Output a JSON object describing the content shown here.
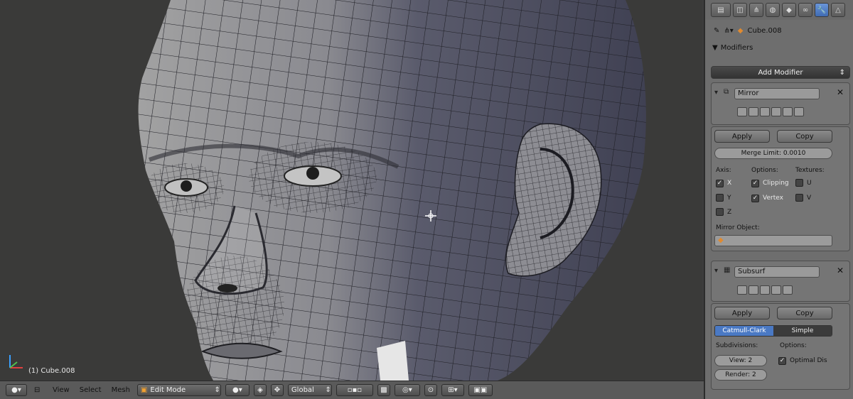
{
  "viewport": {
    "object_label": "(1) Cube.008"
  },
  "header": {
    "menus": [
      "View",
      "Select",
      "Mesh"
    ],
    "mode": "Edit Mode",
    "orientation": "Global"
  },
  "properties": {
    "context_object": "Cube.008",
    "section_title": "Modifiers",
    "add_modifier": "Add Modifier",
    "mirror": {
      "name": "Mirror",
      "apply": "Apply",
      "copy": "Copy",
      "merge_limit": "Merge Limit: 0.0010",
      "axis_heading": "Axis:",
      "options_heading": "Options:",
      "textures_heading": "Textures:",
      "axis_x": "X",
      "axis_y": "Y",
      "axis_z": "Z",
      "clipping": "Clipping",
      "vertex": "Vertex",
      "tex_u": "U",
      "tex_v": "V",
      "mirror_object_label": "Mirror Object:",
      "axis_x_checked": true,
      "axis_y_checked": false,
      "axis_z_checked": false,
      "clipping_checked": true,
      "vertex_checked": true,
      "tex_u_checked": false,
      "tex_v_checked": false
    },
    "subsurf": {
      "name": "Subsurf",
      "apply": "Apply",
      "copy": "Copy",
      "catmull": "Catmull-Clark",
      "simple": "Simple",
      "subdivisions_heading": "Subdivisions:",
      "options_heading": "Options:",
      "view": "View: 2",
      "render": "Render: 2",
      "optimal_display": "Optimal Dis",
      "optimal_checked": true
    }
  },
  "colors": {
    "active_blue": "#4a79c4",
    "panel_bg": "#6e6e6e",
    "mesh_light": "#9a9a9c",
    "mesh_dark": "#45465a"
  }
}
